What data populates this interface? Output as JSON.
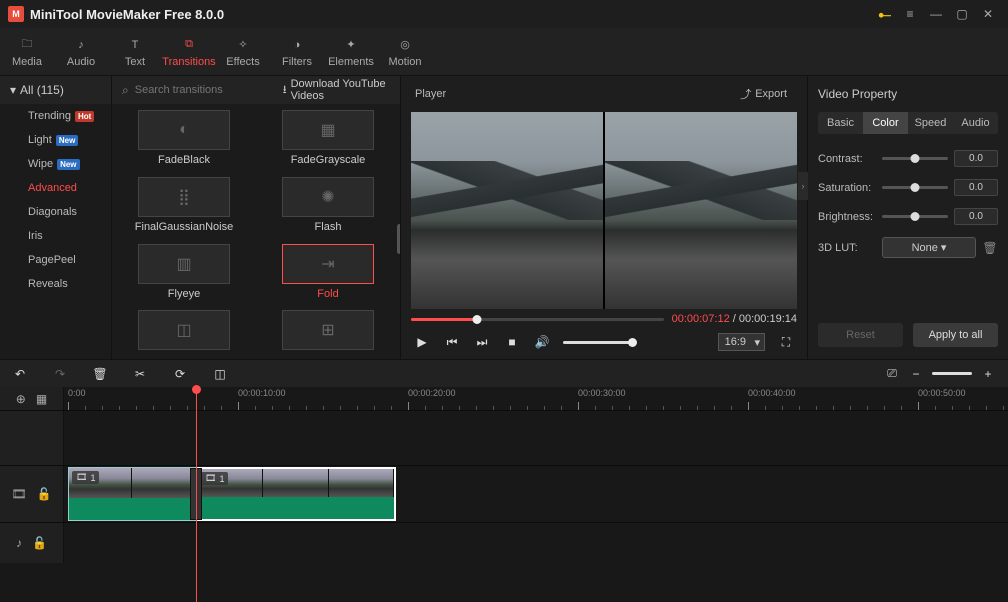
{
  "titlebar": {
    "title": "MiniTool MovieMaker Free 8.0.0"
  },
  "top_tabs": [
    {
      "label": "Media"
    },
    {
      "label": "Audio"
    },
    {
      "label": "Text"
    },
    {
      "label": "Transitions"
    },
    {
      "label": "Effects"
    },
    {
      "label": "Filters"
    },
    {
      "label": "Elements"
    },
    {
      "label": "Motion"
    }
  ],
  "cat": {
    "header": "All (115)",
    "items": [
      {
        "label": "Trending",
        "badge": "Hot"
      },
      {
        "label": "Light",
        "badge": "New"
      },
      {
        "label": "Wipe",
        "badge": "New"
      },
      {
        "label": "Advanced"
      },
      {
        "label": "Diagonals"
      },
      {
        "label": "Iris"
      },
      {
        "label": "PagePeel"
      },
      {
        "label": "Reveals"
      }
    ]
  },
  "trans": {
    "search_ph": "Search transitions",
    "dl": "Download YouTube Videos",
    "items": [
      {
        "label": "FadeBlack"
      },
      {
        "label": "FadeGrayscale"
      },
      {
        "label": "FinalGaussianNoise"
      },
      {
        "label": "Flash"
      },
      {
        "label": "Flyeye"
      },
      {
        "label": "Fold"
      }
    ]
  },
  "preview": {
    "title": "Player",
    "export": "Export",
    "time_cur": "00:00:07:12",
    "time_tot": "00:00:19:14",
    "aspect": "16:9"
  },
  "prop": {
    "title": "Video Property",
    "tabs": [
      "Basic",
      "Color",
      "Speed",
      "Audio"
    ],
    "contrast_l": "Contrast:",
    "saturation_l": "Saturation:",
    "brightness_l": "Brightness:",
    "lut_l": "3D LUT:",
    "lut_v": "None ▾",
    "v0": "0.0",
    "reset": "Reset",
    "apply": "Apply to all"
  },
  "ruler": {
    "labels": [
      "0:00",
      "00:00:10:00",
      "00:00:20:00",
      "00:00:30:00",
      "00:00:40:00",
      "00:00:50:00"
    ]
  },
  "clips": {
    "idx": "1"
  }
}
